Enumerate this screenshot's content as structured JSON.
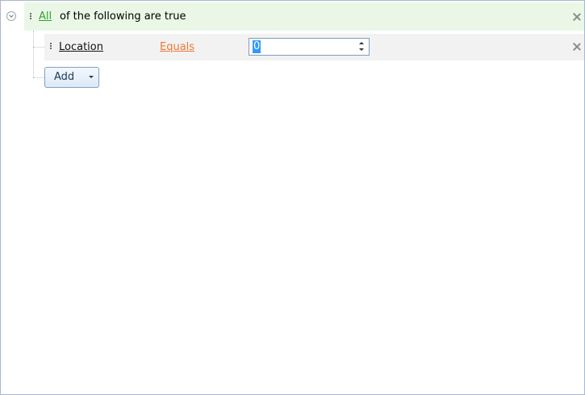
{
  "group": {
    "operator": "All",
    "suffix": "of the following are true"
  },
  "condition": {
    "field": "Location",
    "operator": "Equals",
    "value": "0"
  },
  "add_button": {
    "label": "Add"
  },
  "icons": {
    "collapse": "collapse-circle-icon",
    "grip": "drag-grip-icon",
    "close": "close-x-icon",
    "spin_up": "arrow-up-icon",
    "spin_down": "arrow-down-icon",
    "dropdown": "caret-down-icon"
  },
  "colors": {
    "group_operator": "#2fa42f",
    "condition_operator": "#f07832",
    "group_row_bg": "#eaf7e6",
    "condition_row_bg": "#f2f2f2",
    "selection": "#3399ff",
    "border": "#a7b8cd"
  }
}
